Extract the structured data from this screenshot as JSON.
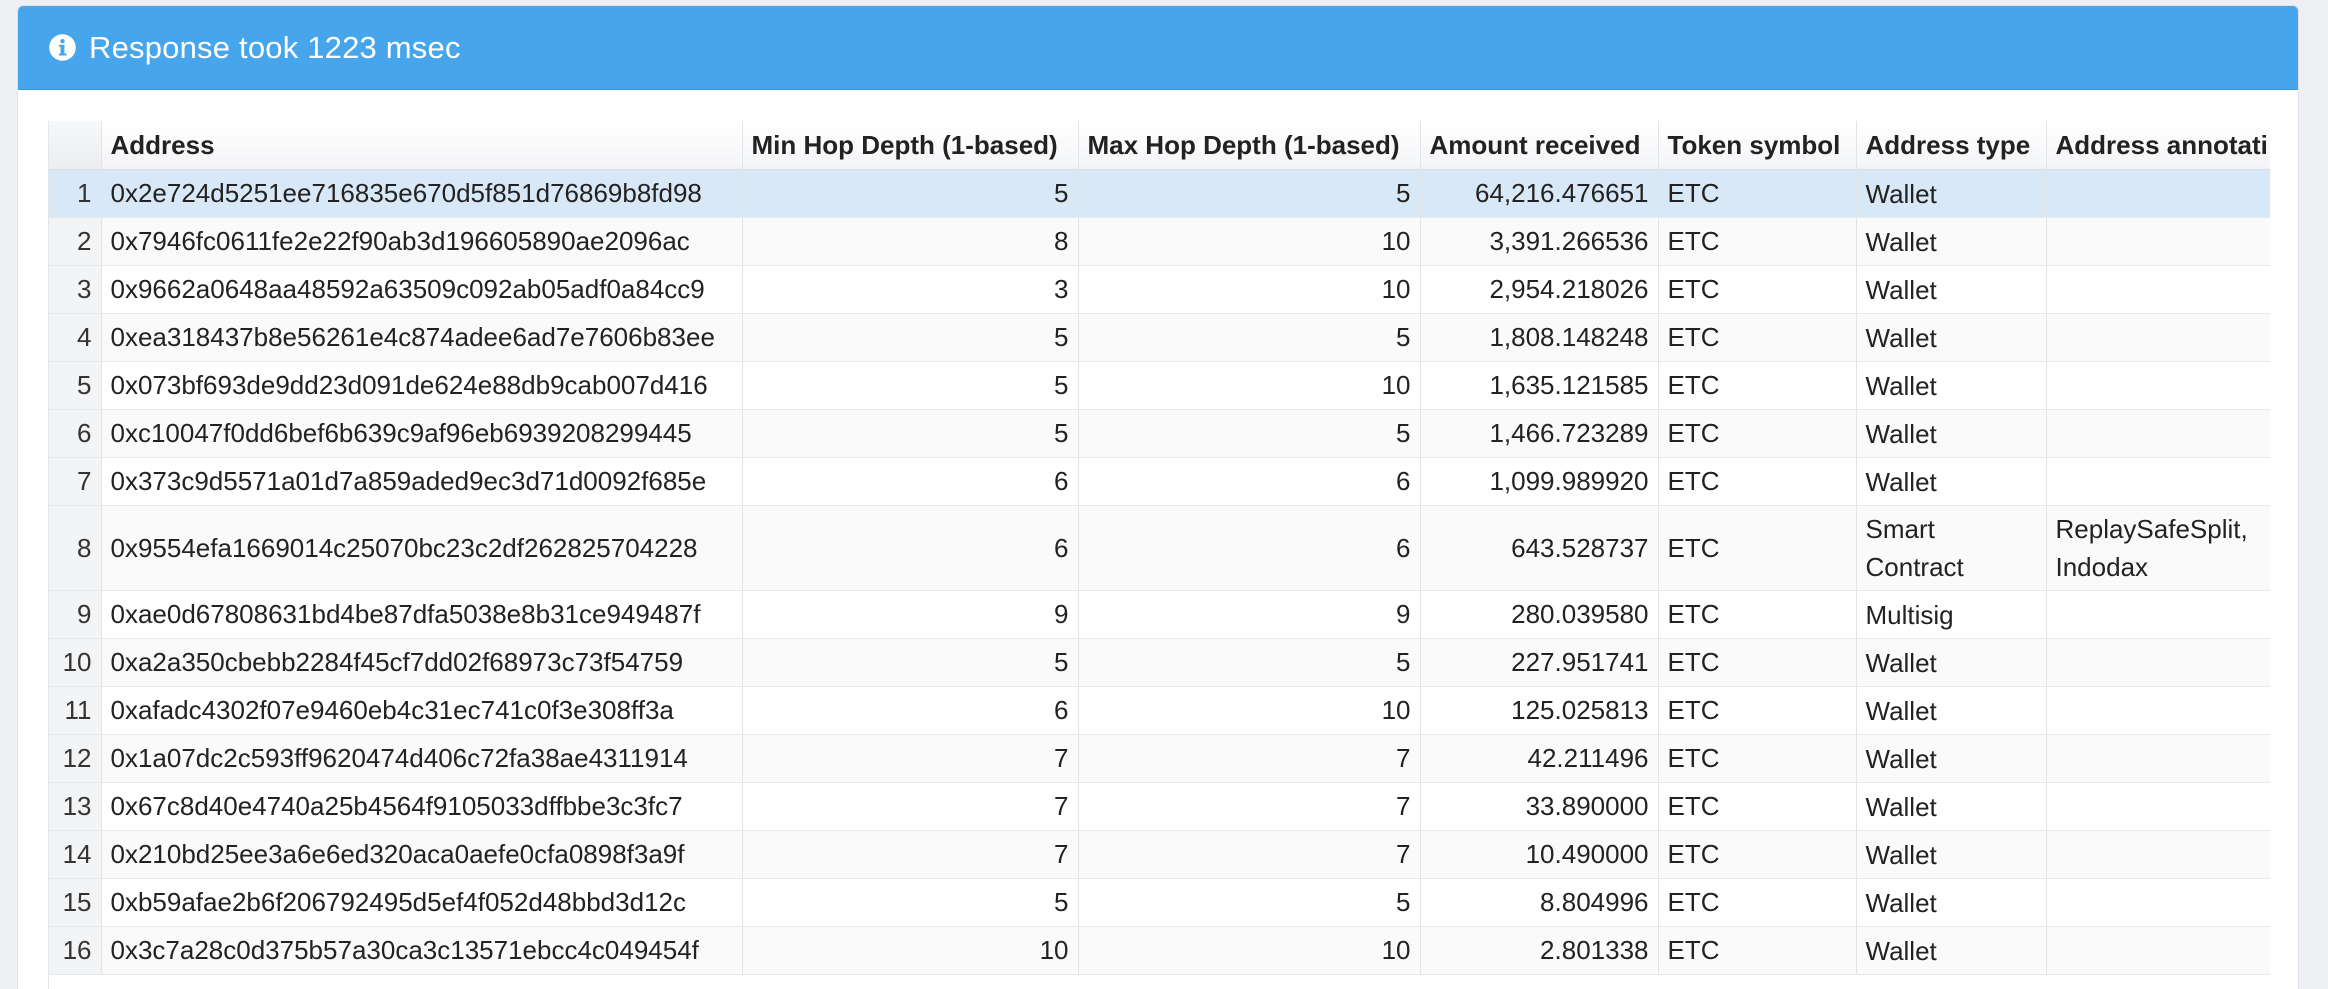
{
  "banner": {
    "message": "Response took 1223 msec",
    "icon": "info-circle-icon",
    "color": "#47a6eb"
  },
  "table": {
    "columns": [
      "",
      "Address",
      "Min Hop Depth (1-based)",
      "Max Hop Depth (1-based)",
      "Amount received",
      "Token symbol",
      "Address type",
      "Address annotati"
    ],
    "selected_row": 1,
    "rows": [
      {
        "idx": "1",
        "address": "0x2e724d5251ee716835e670d5f851d76869b8fd98",
        "min": "5",
        "max": "5",
        "amount": "64,216.476651",
        "token": "ETC",
        "type": "Wallet",
        "annotation": ""
      },
      {
        "idx": "2",
        "address": "0x7946fc0611fe2e22f90ab3d196605890ae2096ac",
        "min": "8",
        "max": "10",
        "amount": "3,391.266536",
        "token": "ETC",
        "type": "Wallet",
        "annotation": ""
      },
      {
        "idx": "3",
        "address": "0x9662a0648aa48592a63509c092ab05adf0a84cc9",
        "min": "3",
        "max": "10",
        "amount": "2,954.218026",
        "token": "ETC",
        "type": "Wallet",
        "annotation": ""
      },
      {
        "idx": "4",
        "address": "0xea318437b8e56261e4c874adee6ad7e7606b83ee",
        "min": "5",
        "max": "5",
        "amount": "1,808.148248",
        "token": "ETC",
        "type": "Wallet",
        "annotation": ""
      },
      {
        "idx": "5",
        "address": "0x073bf693de9dd23d091de624e88db9cab007d416",
        "min": "5",
        "max": "10",
        "amount": "1,635.121585",
        "token": "ETC",
        "type": "Wallet",
        "annotation": ""
      },
      {
        "idx": "6",
        "address": "0xc10047f0dd6bef6b639c9af96eb6939208299445",
        "min": "5",
        "max": "5",
        "amount": "1,466.723289",
        "token": "ETC",
        "type": "Wallet",
        "annotation": ""
      },
      {
        "idx": "7",
        "address": "0x373c9d5571a01d7a859aded9ec3d71d0092f685e",
        "min": "6",
        "max": "6",
        "amount": "1,099.989920",
        "token": "ETC",
        "type": "Wallet",
        "annotation": ""
      },
      {
        "idx": "8",
        "address": "0x9554efa1669014c25070bc23c2df262825704228",
        "min": "6",
        "max": "6",
        "amount": "643.528737",
        "token": "ETC",
        "type": "Smart Contract",
        "annotation": "ReplaySafeSplit, Indodax"
      },
      {
        "idx": "9",
        "address": "0xae0d67808631bd4be87dfa5038e8b31ce949487f",
        "min": "9",
        "max": "9",
        "amount": "280.039580",
        "token": "ETC",
        "type": "Multisig",
        "annotation": ""
      },
      {
        "idx": "10",
        "address": "0xa2a350cbebb2284f45cf7dd02f68973c73f54759",
        "min": "5",
        "max": "5",
        "amount": "227.951741",
        "token": "ETC",
        "type": "Wallet",
        "annotation": ""
      },
      {
        "idx": "11",
        "address": "0xafadc4302f07e9460eb4c31ec741c0f3e308ff3a",
        "min": "6",
        "max": "10",
        "amount": "125.025813",
        "token": "ETC",
        "type": "Wallet",
        "annotation": ""
      },
      {
        "idx": "12",
        "address": "0x1a07dc2c593ff9620474d406c72fa38ae4311914",
        "min": "7",
        "max": "7",
        "amount": "42.211496",
        "token": "ETC",
        "type": "Wallet",
        "annotation": ""
      },
      {
        "idx": "13",
        "address": "0x67c8d40e4740a25b4564f9105033dffbbe3c3fc7",
        "min": "7",
        "max": "7",
        "amount": "33.890000",
        "token": "ETC",
        "type": "Wallet",
        "annotation": ""
      },
      {
        "idx": "14",
        "address": "0x210bd25ee3a6e6ed320aca0aefe0cfa0898f3a9f",
        "min": "7",
        "max": "7",
        "amount": "10.490000",
        "token": "ETC",
        "type": "Wallet",
        "annotation": ""
      },
      {
        "idx": "15",
        "address": "0xb59afae2b6f206792495d5ef4f052d48bbd3d12c",
        "min": "5",
        "max": "5",
        "amount": "8.804996",
        "token": "ETC",
        "type": "Wallet",
        "annotation": ""
      },
      {
        "idx": "16",
        "address": "0x3c7a28c0d375b57a30ca3c13571ebcc4c049454f",
        "min": "10",
        "max": "10",
        "amount": "2.801338",
        "token": "ETC",
        "type": "Wallet",
        "annotation": ""
      }
    ]
  }
}
